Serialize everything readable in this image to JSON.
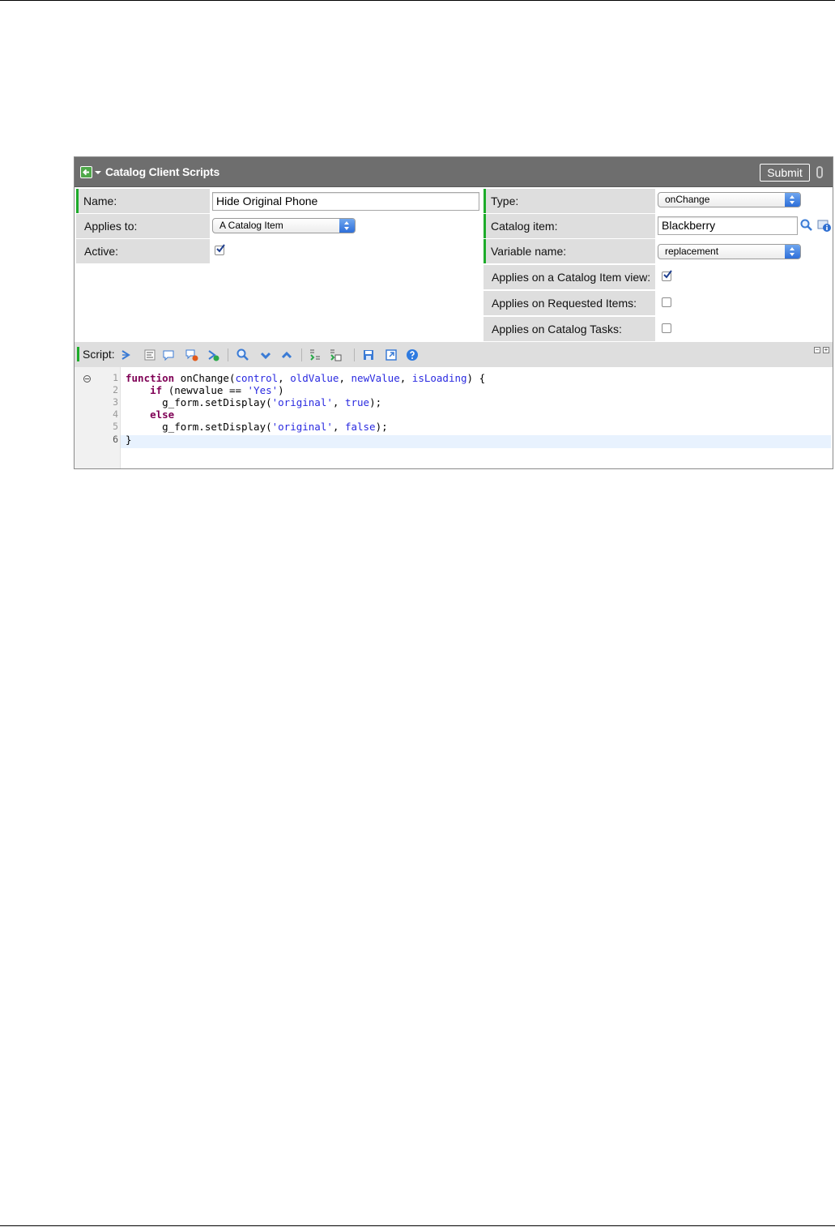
{
  "form": {
    "title": "Catalog Client Scripts",
    "submit_label": "Submit",
    "left": {
      "name_label": "Name:",
      "name_value": "Hide Original Phone",
      "applies_to_label": "Applies to:",
      "applies_to_value": "A Catalog Item",
      "active_label": "Active:",
      "active_checked": true
    },
    "right": {
      "type_label": "Type:",
      "type_value": "onChange",
      "catalog_item_label": "Catalog item:",
      "catalog_item_value": "Blackberry",
      "variable_name_label": "Variable name:",
      "variable_name_value": "replacement",
      "applies_catalog_item_view_label": "Applies on a Catalog Item view:",
      "applies_catalog_item_view_checked": true,
      "applies_requested_items_label": "Applies on Requested Items:",
      "applies_requested_items_checked": false,
      "applies_catalog_tasks_label": "Applies on Catalog Tasks:",
      "applies_catalog_tasks_checked": false
    },
    "script": {
      "label": "Script:",
      "line_numbers": [
        "1",
        "2",
        "3",
        "4",
        "5",
        "6"
      ],
      "lines": [
        "function onChange(control, oldValue, newValue, isLoading) {",
        "    if (newvalue == 'Yes')",
        "      g_form.setDisplay('original', true);",
        "    else",
        "      g_form.setDisplay('original', false);",
        "}"
      ]
    }
  },
  "colors": {
    "title_bar": "#6e6e6e",
    "label_bg": "#dedede",
    "required_marker": "#1dab2a",
    "select_arrow": "#2e6fd9",
    "keyword": "#7f0055",
    "param": "#2a2ae0"
  }
}
